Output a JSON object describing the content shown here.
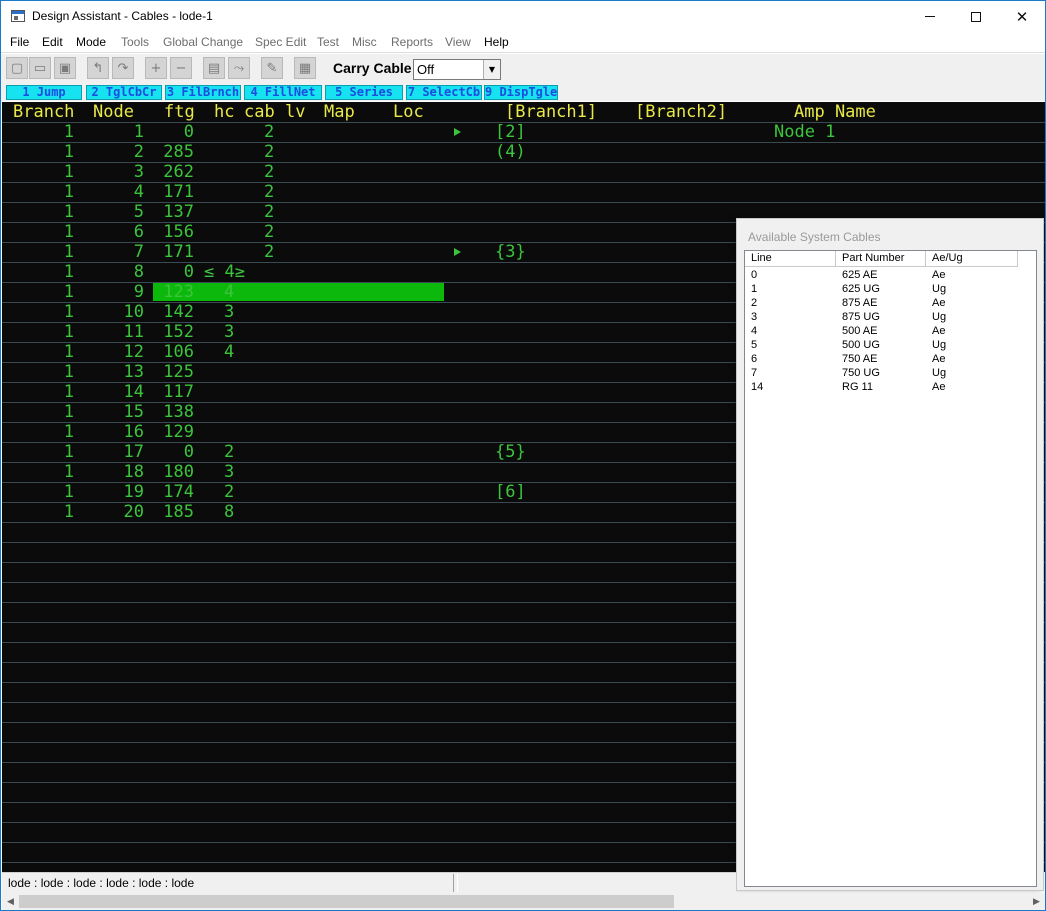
{
  "window": {
    "title": "Design Assistant - Cables - lode-1"
  },
  "menu": [
    {
      "label": "File",
      "enabled": true
    },
    {
      "label": "Edit",
      "enabled": true
    },
    {
      "label": "Mode",
      "enabled": true
    },
    {
      "label": "Tools",
      "enabled": false
    },
    {
      "label": "Global Change",
      "enabled": false
    },
    {
      "label": "Spec Edit",
      "enabled": false
    },
    {
      "label": "Test",
      "enabled": false
    },
    {
      "label": "Misc",
      "enabled": false
    },
    {
      "label": "Reports",
      "enabled": false
    },
    {
      "label": "View",
      "enabled": false
    },
    {
      "label": "Help",
      "enabled": true
    }
  ],
  "toolbar": {
    "icons": [
      "new-file-icon",
      "open-folder-icon",
      "save-icon",
      "undo-icon",
      "redo-icon",
      "add-icon",
      "remove-icon",
      "tv-icon",
      "split-icon",
      "wrench-icon",
      "grid-icon"
    ],
    "carry_label": "Carry Cable",
    "carry_value": "Off"
  },
  "fkeys": [
    "1 Jump",
    "2 TglCbCr",
    "3 FilBrnch",
    "4 FillNet",
    "5 Series",
    "7 SelectCb",
    "9 DispTgle"
  ],
  "grid": {
    "headers": [
      "Branch",
      "Node",
      "ftg",
      "hc",
      "cab",
      "lv",
      "Map",
      "Loc",
      "[Branch1]",
      "[Branch2]",
      "Amp Name"
    ],
    "rows": [
      {
        "branch": "1",
        "node": "1",
        "ftg": "0",
        "hc": "",
        "cab": "2",
        "branch1": "[2]",
        "amp": "Node 1",
        "marker": true
      },
      {
        "branch": "1",
        "node": "2",
        "ftg": "285",
        "hc": "",
        "cab": "2",
        "branch1": "(4)",
        "amp": "",
        "marker": false
      },
      {
        "branch": "1",
        "node": "3",
        "ftg": "262",
        "hc": "",
        "cab": "2",
        "branch1": "",
        "amp": "",
        "marker": false
      },
      {
        "branch": "1",
        "node": "4",
        "ftg": "171",
        "hc": "",
        "cab": "2",
        "branch1": "",
        "amp": "",
        "marker": false
      },
      {
        "branch": "1",
        "node": "5",
        "ftg": "137",
        "hc": "",
        "cab": "2",
        "branch1": "",
        "amp": "",
        "marker": false
      },
      {
        "branch": "1",
        "node": "6",
        "ftg": "156",
        "hc": "",
        "cab": "2",
        "branch1": "",
        "amp": "",
        "marker": false
      },
      {
        "branch": "1",
        "node": "7",
        "ftg": "171",
        "hc": "",
        "cab": "2",
        "branch1": "{3}",
        "amp": "",
        "marker": true
      },
      {
        "branch": "1",
        "node": "8",
        "ftg": "0",
        "hc": "≤ 4≥",
        "cab": "",
        "branch1": "",
        "amp": "",
        "marker": false
      },
      {
        "branch": "1",
        "node": "9",
        "ftg": "123",
        "hc": "4",
        "cab": "",
        "branch1": "",
        "amp": "",
        "marker": false,
        "selected": true
      },
      {
        "branch": "1",
        "node": "10",
        "ftg": "142",
        "hc": "3",
        "cab": "",
        "branch1": "",
        "amp": "",
        "marker": false
      },
      {
        "branch": "1",
        "node": "11",
        "ftg": "152",
        "hc": "3",
        "cab": "",
        "branch1": "",
        "amp": "",
        "marker": false
      },
      {
        "branch": "1",
        "node": "12",
        "ftg": "106",
        "hc": "4",
        "cab": "",
        "branch1": "",
        "amp": "",
        "marker": false
      },
      {
        "branch": "1",
        "node": "13",
        "ftg": "125",
        "hc": "",
        "cab": "",
        "branch1": "",
        "amp": "",
        "marker": false
      },
      {
        "branch": "1",
        "node": "14",
        "ftg": "117",
        "hc": "",
        "cab": "",
        "branch1": "",
        "amp": "",
        "marker": false
      },
      {
        "branch": "1",
        "node": "15",
        "ftg": "138",
        "hc": "",
        "cab": "",
        "branch1": "",
        "amp": "",
        "marker": false
      },
      {
        "branch": "1",
        "node": "16",
        "ftg": "129",
        "hc": "",
        "cab": "",
        "branch1": "",
        "amp": "",
        "marker": false
      },
      {
        "branch": "1",
        "node": "17",
        "ftg": "0",
        "hc": "2",
        "cab": "",
        "branch1": "{5}",
        "amp": "",
        "marker": false
      },
      {
        "branch": "1",
        "node": "18",
        "ftg": "180",
        "hc": "3",
        "cab": "",
        "branch1": "",
        "amp": "",
        "marker": false
      },
      {
        "branch": "1",
        "node": "19",
        "ftg": "174",
        "hc": "2",
        "cab": "",
        "branch1": "[6]",
        "amp": "",
        "marker": false
      },
      {
        "branch": "1",
        "node": "20",
        "ftg": "185",
        "hc": "8",
        "cab": "",
        "branch1": "",
        "amp": "",
        "marker": false
      }
    ]
  },
  "cables_panel": {
    "title": "Available System Cables",
    "columns": [
      "Line",
      "Part Number",
      "Ae/Ug"
    ],
    "rows": [
      [
        "0",
        "625 AE",
        "Ae"
      ],
      [
        "1",
        "625 UG",
        "Ug"
      ],
      [
        "2",
        "875 AE",
        "Ae"
      ],
      [
        "3",
        "875 UG",
        "Ug"
      ],
      [
        "4",
        "500 AE",
        "Ae"
      ],
      [
        "5",
        "500 UG",
        "Ug"
      ],
      [
        "6",
        "750 AE",
        "Ae"
      ],
      [
        "7",
        "750 UG",
        "Ug"
      ],
      [
        "14",
        "RG 11",
        "Ae"
      ]
    ]
  },
  "status": {
    "text": "lode : lode : lode : lode : lode : lode"
  },
  "colors": {
    "grid_bg": "#0b0b0b",
    "header_text": "#e8e84a",
    "cell_text": "#3cc43c",
    "selection": "#0cb80c",
    "fkey_bg": "#16e2f0",
    "fkey_text": "#1b4de0"
  }
}
